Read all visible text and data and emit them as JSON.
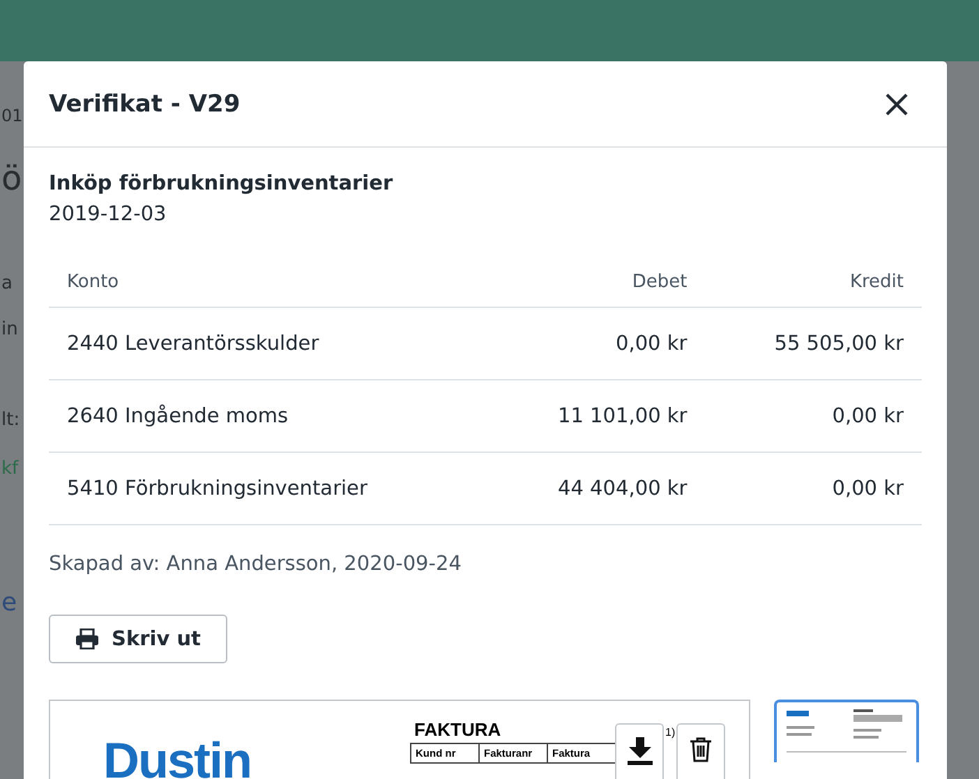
{
  "background": {
    "fragments": [
      {
        "kind": "small",
        "text": "01"
      },
      {
        "kind": "heading",
        "text": "ö"
      },
      {
        "kind": "text",
        "text": "a"
      },
      {
        "kind": "text",
        "text": "in"
      },
      {
        "kind": "text",
        "text": "lt:"
      },
      {
        "kind": "link",
        "text": "kf"
      },
      {
        "kind": "big-link",
        "text": "e"
      }
    ]
  },
  "modal": {
    "title": "Verifikat - V29",
    "description": "Inköp förbrukningsinventarier",
    "date": "2019-12-03",
    "table": {
      "columns": [
        "Konto",
        "Debet",
        "Kredit"
      ],
      "rows": [
        {
          "konto": "2440 Leverantörsskulder",
          "debet": "0,00 kr",
          "kredit": "55 505,00 kr"
        },
        {
          "konto": "2640 Ingående moms",
          "debet": "11 101,00 kr",
          "kredit": "0,00 kr"
        },
        {
          "konto": "5410 Förbrukningsinventarier",
          "debet": "44 404,00 kr",
          "kredit": "0,00 kr"
        }
      ]
    },
    "created_by": "Skapad av: Anna Andersson, 2020-09-24",
    "print_button": "Skriv ut",
    "attachment": {
      "logo": "Dustin",
      "doc_title": "FAKTURA",
      "page_note": "1)",
      "headers": [
        "Kund nr",
        "Fakturanr",
        "Faktura"
      ]
    },
    "thumbnails": [
      {
        "selected": true
      }
    ]
  }
}
